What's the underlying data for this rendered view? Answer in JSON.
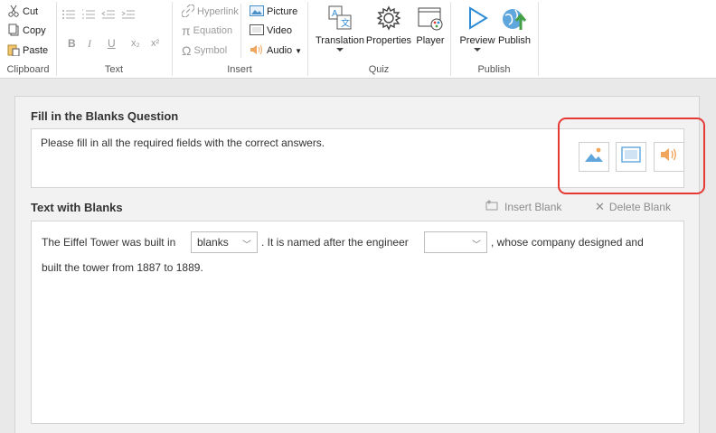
{
  "ribbon": {
    "clipboard": {
      "cut": "Cut",
      "copy": "Copy",
      "paste": "Paste",
      "group": "Clipboard"
    },
    "text": {
      "bold": "B",
      "italic": "I",
      "underline": "U",
      "subscript": "x₂",
      "superscript": "x²",
      "group": "Text"
    },
    "insert": {
      "hyperlink": "Hyperlink",
      "equation": "Equation",
      "symbol": "Symbol",
      "picture": "Picture",
      "video": "Video",
      "audio": "Audio",
      "group": "Insert"
    },
    "quiz": {
      "translation": "Translation",
      "properties": "Properties",
      "player": "Player",
      "group": "Quiz"
    },
    "publish": {
      "preview": "Preview",
      "publish": "Publish",
      "group": "Publish"
    }
  },
  "question": {
    "title": "Fill in the Blanks Question",
    "text": "Please fill in all the required fields with the correct answers."
  },
  "blanks": {
    "title": "Text with Blanks",
    "insert_blank": "Insert Blank",
    "delete_blank": "Delete Blank",
    "segment1": "The Eiffel Tower was built in",
    "blank1_value": "blanks",
    "segment2": ". It is named after the engineer",
    "blank2_value": "",
    "segment3": ", whose company designed and",
    "line2": "built the tower from 1887 to 1889."
  },
  "colors": {
    "accent_blue": "#2e8bd6",
    "highlight_red": "#e53935",
    "audio_orange": "#f0a55a"
  }
}
